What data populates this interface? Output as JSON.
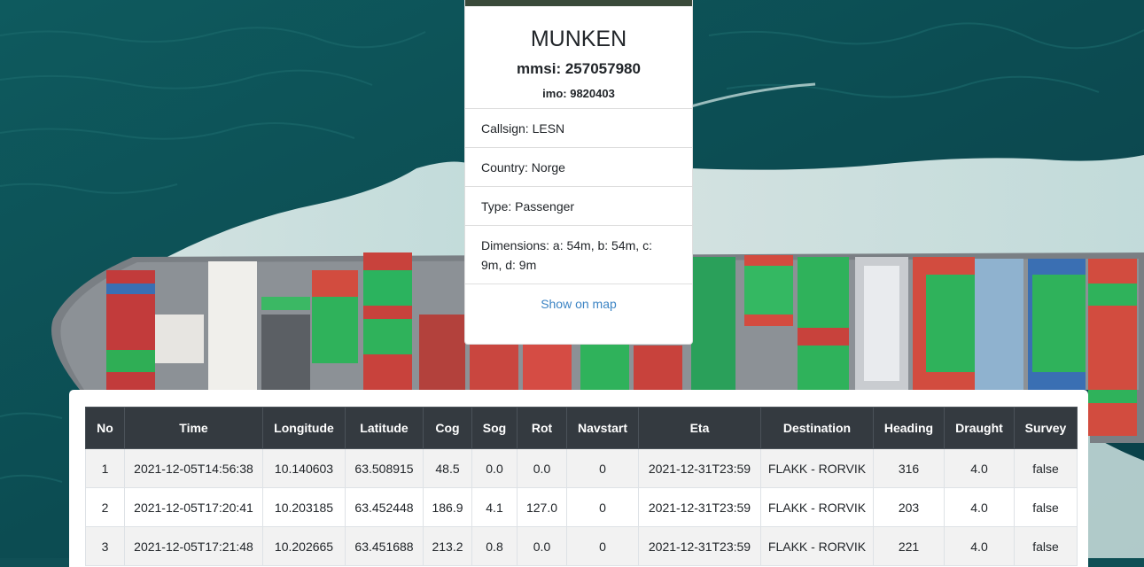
{
  "vessel": {
    "name": "MUNKEN",
    "mmsi": "mmsi: 257057980",
    "imo": "imo: 9820403",
    "callsign": "Callsign: LESN",
    "country": "Country: Norge",
    "type": "Type: Passenger",
    "dimensions": "Dimensions: a: 54m, b: 54m, c: 9m, d: 9m",
    "map_link": "Show on map"
  },
  "table": {
    "columns": [
      "No",
      "Time",
      "Longitude",
      "Latitude",
      "Cog",
      "Sog",
      "Rot",
      "Navstart",
      "Eta",
      "Destination",
      "Heading",
      "Draught",
      "Survey"
    ],
    "rows": [
      [
        "1",
        "2021-12-05T14:56:38",
        "10.140603",
        "63.508915",
        "48.5",
        "0.0",
        "0.0",
        "0",
        "2021-12-31T23:59",
        "FLAKK - RORVIK",
        "316",
        "4.0",
        "false"
      ],
      [
        "2",
        "2021-12-05T17:20:41",
        "10.203185",
        "63.452448",
        "186.9",
        "4.1",
        "127.0",
        "0",
        "2021-12-31T23:59",
        "FLAKK - RORVIK",
        "203",
        "4.0",
        "false"
      ],
      [
        "3",
        "2021-12-05T17:21:48",
        "10.202665",
        "63.451688",
        "213.2",
        "0.8",
        "0.0",
        "0",
        "2021-12-31T23:59",
        "FLAKK - RORVIK",
        "221",
        "4.0",
        "false"
      ]
    ]
  },
  "colors": {
    "sea": "#0f4f55",
    "table_header": "#343a40",
    "link": "#3c84c4"
  }
}
